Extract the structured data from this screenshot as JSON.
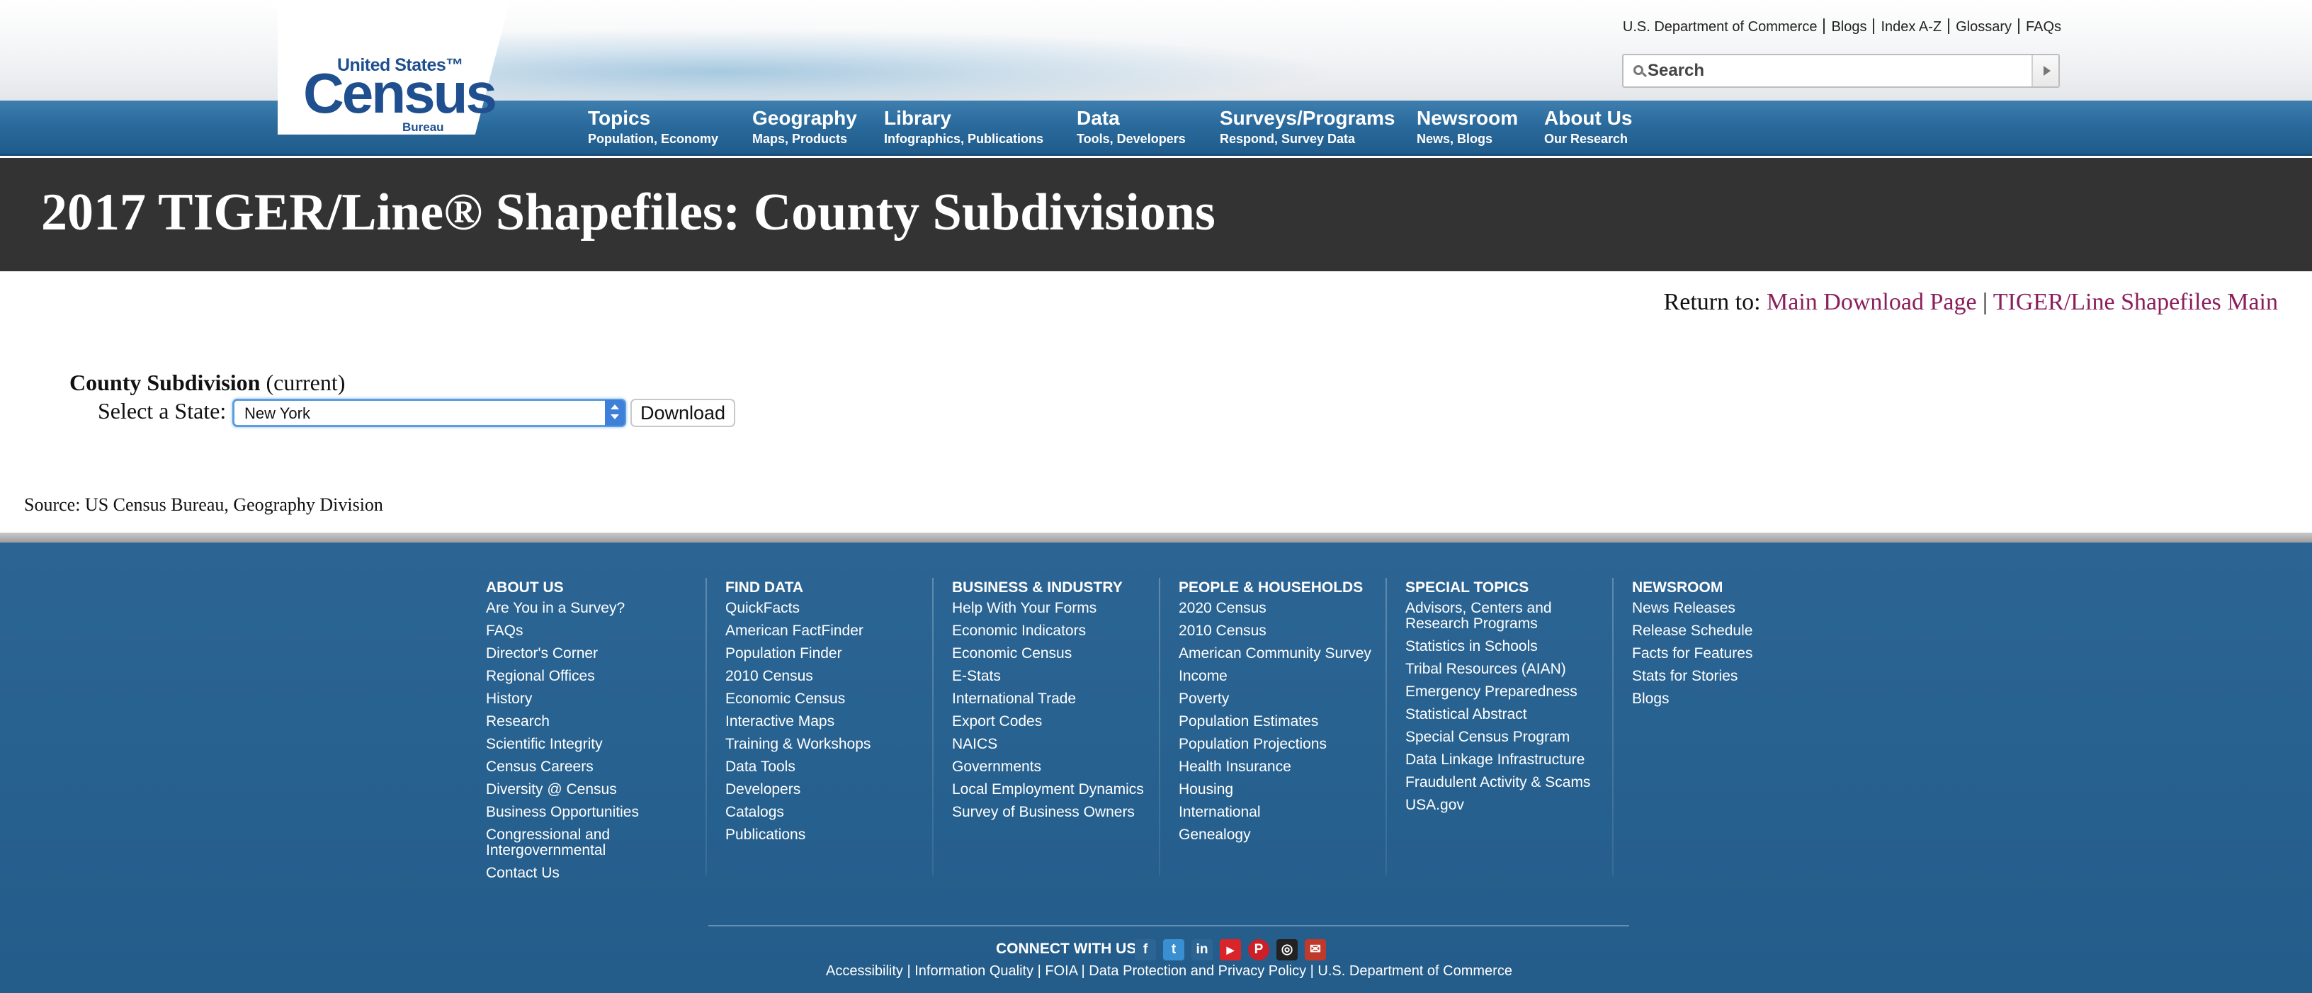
{
  "header": {
    "logo": {
      "line1": "United States™",
      "line2": "Census",
      "line3": "Bureau"
    },
    "utility_links": [
      "U.S. Department of Commerce",
      "Blogs",
      "Index A-Z",
      "Glossary",
      "FAQs"
    ],
    "search": {
      "placeholder": "Search"
    },
    "nav": [
      {
        "title": "Topics",
        "sub": "Population, Economy"
      },
      {
        "title": "Geography",
        "sub": "Maps, Products"
      },
      {
        "title": "Library",
        "sub": "Infographics, Publications"
      },
      {
        "title": "Data",
        "sub": "Tools, Developers"
      },
      {
        "title": "Surveys/Programs",
        "sub": "Respond, Survey Data"
      },
      {
        "title": "Newsroom",
        "sub": "News, Blogs"
      },
      {
        "title": "About Us",
        "sub": "Our Research"
      }
    ]
  },
  "page": {
    "title": "2017 TIGER/Line® Shapefiles: County Subdivisions",
    "return_to": {
      "label": "Return to:",
      "links": [
        "Main Download Page",
        "TIGER/Line Shapefiles Main"
      ],
      "separator": "|"
    },
    "section": {
      "heading_bold": "County Subdivision",
      "heading_rest": "(current)",
      "select_label": "Select a State:",
      "selected_state": "New York",
      "download_label": "Download"
    },
    "source": "Source: US Census Bureau, Geography Division"
  },
  "footer": {
    "columns": [
      {
        "heading": "ABOUT US",
        "links": [
          "Are You in a Survey?",
          "FAQs",
          "Director's Corner",
          "Regional Offices",
          "History",
          "Research",
          "Scientific Integrity",
          "Census Careers",
          "Diversity @ Census",
          "Business Opportunities",
          "Congressional and Intergovernmental",
          "Contact Us"
        ]
      },
      {
        "heading": "FIND DATA",
        "links": [
          "QuickFacts",
          "American FactFinder",
          "Population Finder",
          "2010 Census",
          "Economic Census",
          "Interactive Maps",
          "Training & Workshops",
          "Data Tools",
          "Developers",
          "Catalogs",
          "Publications"
        ]
      },
      {
        "heading": "BUSINESS & INDUSTRY",
        "links": [
          "Help With Your Forms",
          "Economic Indicators",
          "Economic Census",
          "E-Stats",
          "International Trade",
          "Export Codes",
          "NAICS",
          "Governments",
          "Local Employment Dynamics",
          "Survey of Business Owners"
        ]
      },
      {
        "heading": "PEOPLE & HOUSEHOLDS",
        "links": [
          "2020 Census",
          "2010 Census",
          "American Community Survey",
          "Income",
          "Poverty",
          "Population Estimates",
          "Population Projections",
          "Health Insurance",
          "Housing",
          "International",
          "Genealogy"
        ]
      },
      {
        "heading": "SPECIAL TOPICS",
        "links": [
          "Advisors, Centers and Research Programs",
          "Statistics in Schools",
          "Tribal Resources (AIAN)",
          "Emergency Preparedness",
          "Statistical Abstract",
          "Special Census Program",
          "Data Linkage Infrastructure",
          "Fraudulent Activity & Scams",
          "USA.gov"
        ]
      },
      {
        "heading": "NEWSROOM",
        "links": [
          "News Releases",
          "Release Schedule",
          "Facts for Features",
          "Stats for Stories",
          "Blogs"
        ]
      }
    ],
    "connect_label": "CONNECT WITH US",
    "social": [
      {
        "icon": "facebook-icon",
        "glyph": "f",
        "color": "#2c6594"
      },
      {
        "icon": "twitter-icon",
        "glyph": "t",
        "color": "#3a8fd0"
      },
      {
        "icon": "linkedin-icon",
        "glyph": "in",
        "color": "#2c6594"
      },
      {
        "icon": "youtube-icon",
        "glyph": "▶",
        "color": "#d9252a"
      },
      {
        "icon": "pinterest-icon",
        "glyph": "P",
        "color": "#cb2027"
      },
      {
        "icon": "instagram-icon",
        "glyph": "◎",
        "color": "#222222"
      },
      {
        "icon": "email-icon",
        "glyph": "✉",
        "color": "#c0392b"
      }
    ],
    "bottom_links": [
      "Accessibility",
      "Information Quality",
      "FOIA",
      "Data Protection and Privacy Policy",
      "U.S. Department of Commerce"
    ]
  }
}
